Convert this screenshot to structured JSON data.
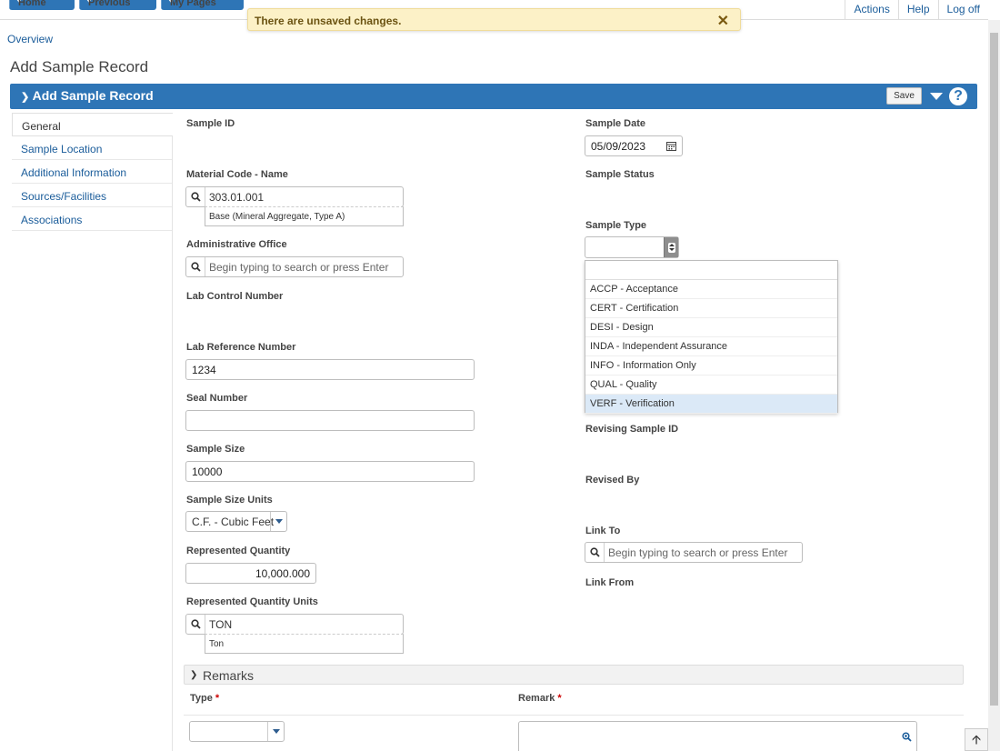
{
  "nav": {
    "home": "Home",
    "previous": "Previous",
    "my_pages": "My Pages",
    "links": [
      "Actions",
      "Help",
      "Log off"
    ]
  },
  "toast": {
    "message": "There are unsaved changes."
  },
  "breadcrumb": "Overview",
  "page_title": "Add Sample Record",
  "panel": {
    "title": "Add Sample Record",
    "save_label": "Save"
  },
  "sidebar": {
    "items": [
      {
        "label": "General"
      },
      {
        "label": "Sample Location"
      },
      {
        "label": "Additional Information"
      },
      {
        "label": "Sources/Facilities"
      },
      {
        "label": "Associations"
      }
    ]
  },
  "form": {
    "sample_id_label": "Sample ID",
    "material_label": "Material Code - Name",
    "material_value": "303.01.001",
    "material_desc": "Base (Mineral Aggregate, Type A)",
    "admin_office_label": "Administrative Office",
    "admin_office_placeholder": "Begin typing to search or press Enter",
    "lab_control_label": "Lab Control Number",
    "lab_ref_label": "Lab Reference Number",
    "lab_ref_value": "1234",
    "seal_label": "Seal Number",
    "sample_size_label": "Sample Size",
    "sample_size_value": "10000",
    "size_units_label": "Sample Size Units",
    "size_units_value": "C.F. - Cubic Feet",
    "rep_qty_label": "Represented Quantity",
    "rep_qty_value": "10,000.000",
    "rep_qty_units_label": "Represented Quantity Units",
    "rep_qty_units_value": "TON",
    "rep_qty_units_desc": "Ton",
    "sample_date_label": "Sample Date",
    "sample_date_value": "05/09/2023",
    "sample_status_label": "Sample Status",
    "sample_type_label": "Sample Type",
    "revising_label": "Revising Sample ID",
    "revised_by_label": "Revised By",
    "link_to_label": "Link To",
    "link_to_placeholder": "Begin typing to search or press Enter",
    "link_from_label": "Link From"
  },
  "sample_type_options": [
    {
      "label": "ACCP - Acceptance"
    },
    {
      "label": "CERT - Certification"
    },
    {
      "label": "DESI - Design"
    },
    {
      "label": "INDA - Independent Assurance"
    },
    {
      "label": "INFO - Information Only"
    },
    {
      "label": "QUAL - Quality"
    },
    {
      "label": "VERF - Verification"
    }
  ],
  "remarks": {
    "title": "Remarks",
    "type_label": "Type",
    "remark_label": "Remark",
    "required_mark": "*"
  },
  "colors": {
    "accent": "#2e75b6",
    "toast_bg": "#fcf1c7",
    "selected_option": "#dbe9f7"
  }
}
